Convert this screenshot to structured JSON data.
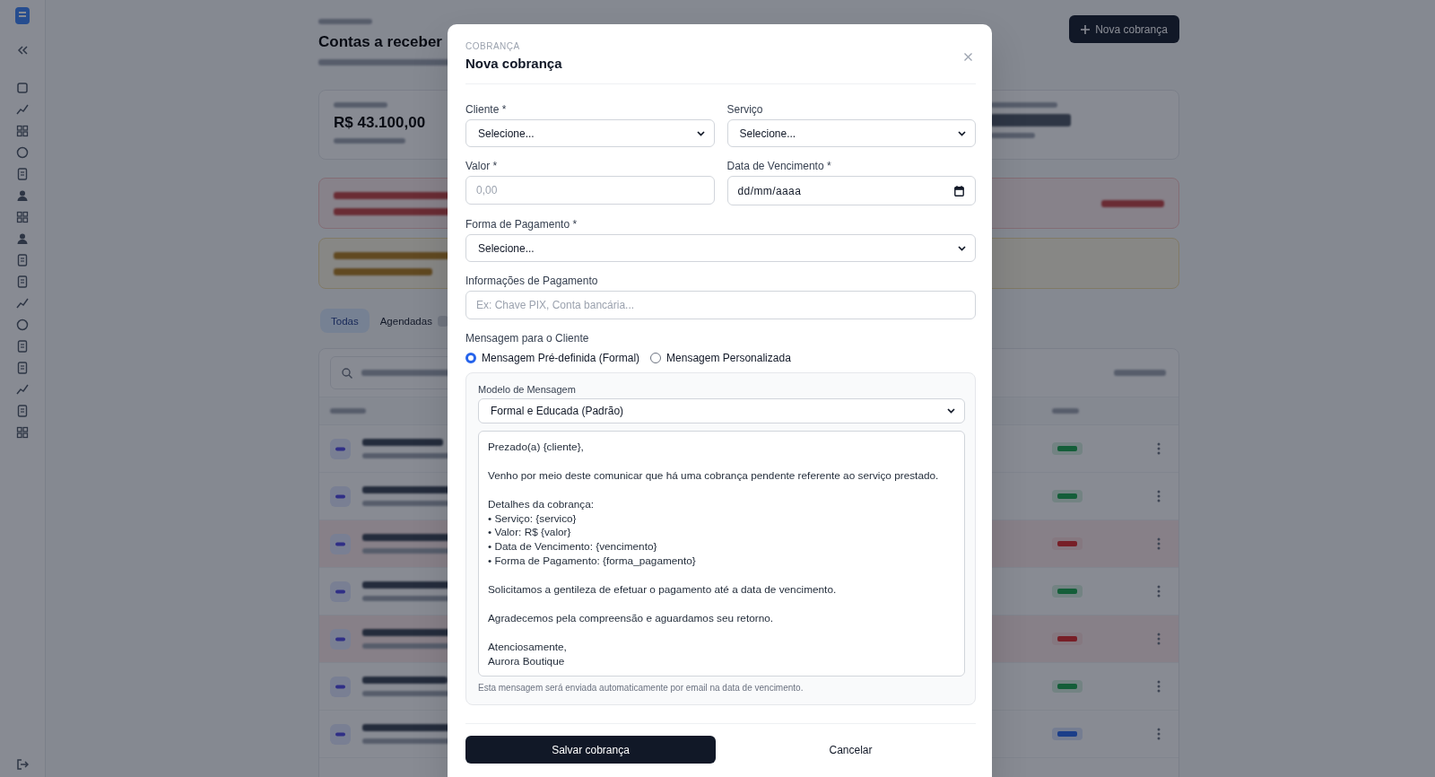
{
  "page": {
    "title": "Contas a receber",
    "new_button": "Nova cobrança",
    "summary_value": "R$ 43.100,00"
  },
  "alerts": [
    {
      "kind": "danger"
    },
    {
      "kind": "warning"
    }
  ],
  "tabs": [
    {
      "label": "Todas",
      "selected": true
    },
    {
      "label": "Agendadas",
      "selected": false
    }
  ],
  "table": {
    "rows": [
      {
        "highlighted": false,
        "color": "#145e39"
      },
      {
        "highlighted": false,
        "color": "#145e39"
      },
      {
        "highlighted": true,
        "color": "#771f27"
      },
      {
        "highlighted": false,
        "color": "#145e39"
      },
      {
        "highlighted": true,
        "color": "#771f27"
      },
      {
        "highlighted": false,
        "color": "#145e39"
      },
      {
        "highlighted": false,
        "color": "#1b3e89"
      }
    ]
  },
  "modal": {
    "eyebrow": "COBRANÇA",
    "title": "Nova cobrança",
    "rows": [
      [
        {
          "kind": "select",
          "label": "Cliente *",
          "value": "Selecione..."
        },
        {
          "kind": "select",
          "label": "Serviço",
          "value": "Selecione..."
        }
      ],
      [
        {
          "kind": "text",
          "label": "Valor *",
          "placeholder": "0,00"
        },
        {
          "kind": "date",
          "label": "Data de Vencimento *",
          "placeholder": "dd/mm/aaaa"
        }
      ],
      [
        {
          "kind": "select",
          "label": "Forma de Pagamento *",
          "value": "Selecione..."
        }
      ],
      [
        {
          "kind": "text",
          "label": "Informações de Pagamento",
          "placeholder": "Ex: Chave PIX, Conta bancária..."
        }
      ]
    ],
    "message": {
      "label": "Mensagem para o Cliente",
      "options": [
        {
          "label": "Mensagem Pré-definida (Formal)",
          "selected": true
        },
        {
          "label": "Mensagem Personalizada",
          "selected": false
        }
      ],
      "template_label": "Modelo de Mensagem",
      "template": "Formal e Educada (Padrão)",
      "body": "Prezado(a) {cliente},\n\nVenho por meio deste comunicar que há uma cobrança pendente referente ao serviço prestado.\n\nDetalhes da cobrança:\n• Serviço: {servico}\n• Valor: R$ {valor}\n• Data de Vencimento: {vencimento}\n• Forma de Pagamento: {forma_pagamento}\n\nSolicitamos a gentileza de efetuar o pagamento até a data de vencimento.\n\nAgradecemos pela compreensão e aguardamos seu retorno.\n\nAtenciosamente,\nAurora Boutique",
      "hint": "Esta mensagem será enviada automaticamente por email na data de vencimento."
    },
    "actions": [
      {
        "kind": "primary",
        "label": "Salvar cobrança"
      },
      {
        "kind": "secondary",
        "label": "Cancelar"
      }
    ]
  }
}
